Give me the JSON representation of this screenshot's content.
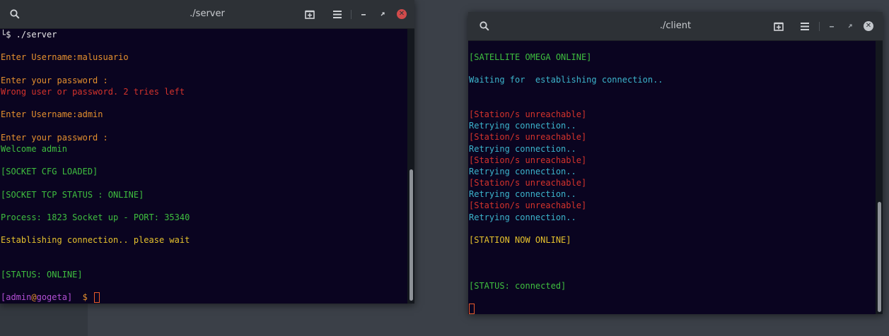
{
  "server": {
    "title": "./server",
    "lines": [
      {
        "text": "└$ ./server",
        "color": "white"
      },
      {
        "text": "",
        "color": "white"
      },
      {
        "text": "Enter Username:malusuario",
        "color": "orange"
      },
      {
        "text": "",
        "color": "white"
      },
      {
        "text": "Enter your password :",
        "color": "orange"
      },
      {
        "text": "Wrong user or password. 2 tries left",
        "color": "red"
      },
      {
        "text": "",
        "color": "white"
      },
      {
        "text": "Enter Username:admin",
        "color": "orange"
      },
      {
        "text": "",
        "color": "white"
      },
      {
        "text": "Enter your password :",
        "color": "orange"
      },
      {
        "text": "Welcome admin",
        "color": "green"
      },
      {
        "text": "",
        "color": "white"
      },
      {
        "text": "[SOCKET CFG LOADED]",
        "color": "green"
      },
      {
        "text": "",
        "color": "white"
      },
      {
        "text": "[SOCKET TCP STATUS : ONLINE]",
        "color": "green"
      },
      {
        "text": "",
        "color": "white"
      },
      {
        "text": "Process: 1823 Socket up - PORT: 35340",
        "color": "green"
      },
      {
        "text": "",
        "color": "white"
      },
      {
        "text": "Establishing connection.. please wait",
        "color": "yellow"
      },
      {
        "text": "",
        "color": "white"
      },
      {
        "text": "",
        "color": "white"
      },
      {
        "text": "[STATUS: ONLINE]",
        "color": "green"
      },
      {
        "text": "",
        "color": "white"
      }
    ],
    "prompt": {
      "open": "[",
      "user": "admin",
      "at": "@",
      "host": "gogeta",
      "close": "]",
      "dollar": "$"
    }
  },
  "client": {
    "title": "./client",
    "lines": [
      {
        "text": "[SATELLITE OMEGA ONLINE]",
        "color": "green"
      },
      {
        "text": "",
        "color": "white"
      },
      {
        "text": "Waiting for  establishing connection..",
        "color": "cyan"
      },
      {
        "text": "",
        "color": "white"
      },
      {
        "text": "",
        "color": "white"
      },
      {
        "text": "[Station/s unreachable]",
        "color": "red"
      },
      {
        "text": "Retrying connection..",
        "color": "cyan"
      },
      {
        "text": "[Station/s unreachable]",
        "color": "red"
      },
      {
        "text": "Retrying connection..",
        "color": "cyan"
      },
      {
        "text": "[Station/s unreachable]",
        "color": "red"
      },
      {
        "text": "Retrying connection..",
        "color": "cyan"
      },
      {
        "text": "[Station/s unreachable]",
        "color": "red"
      },
      {
        "text": "Retrying connection..",
        "color": "cyan"
      },
      {
        "text": "[Station/s unreachable]",
        "color": "red"
      },
      {
        "text": "Retrying connection..",
        "color": "cyan"
      },
      {
        "text": "",
        "color": "white"
      },
      {
        "text": "[STATION NOW ONLINE]",
        "color": "yellow"
      },
      {
        "text": "",
        "color": "white"
      },
      {
        "text": "",
        "color": "white"
      },
      {
        "text": "",
        "color": "white"
      },
      {
        "text": "[STATUS: connected]",
        "color": "green"
      },
      {
        "text": "",
        "color": "white"
      }
    ]
  },
  "icons": {
    "search": "search-icon",
    "new_tab": "new-tab-icon",
    "menu": "hamburger-menu-icon",
    "minimize": "minimize-icon",
    "maximize": "maximize-icon",
    "close": "close-icon"
  },
  "colors": {
    "terminal_bg": "#0a0420",
    "titlebar_bg": "#2d3136",
    "white": "#e8e8e8",
    "orange": "#e5902e",
    "red": "#d5332c",
    "green": "#3fbf3f",
    "yellow": "#e5c12d",
    "cyan": "#3cb4cc",
    "purple": "#b24fd4",
    "close_active": "#d24b4b"
  }
}
